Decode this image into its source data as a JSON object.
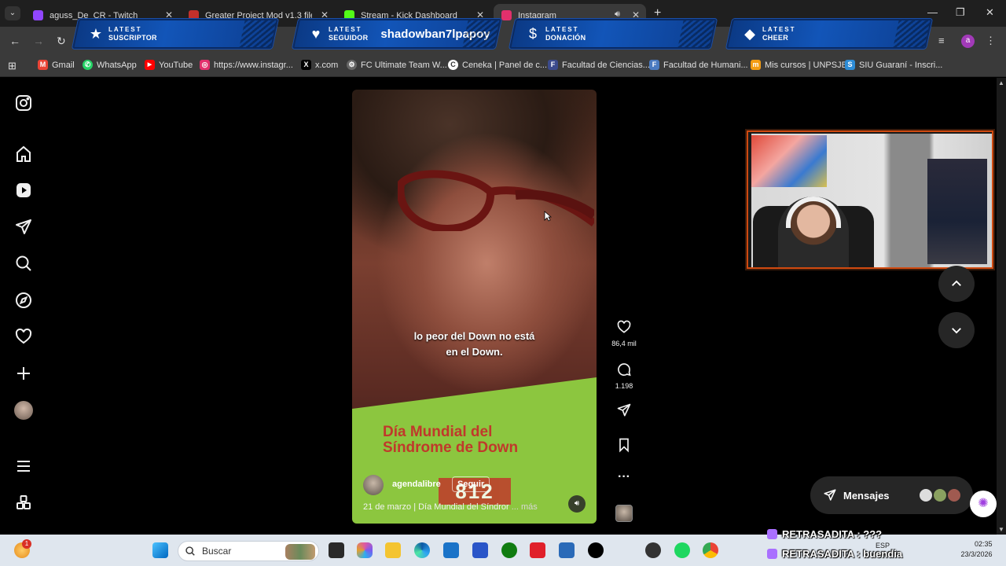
{
  "tabs": [
    {
      "title": "aguss_De_CR - Twitch",
      "color": "#9146ff",
      "active": false
    },
    {
      "title": "Greater Project Mod v1.3 file - ",
      "color": "#c4302b",
      "active": false
    },
    {
      "title": "Stream - Kick Dashboard",
      "color": "#53fc18",
      "active": false
    },
    {
      "title": "Instagram",
      "color": "#e1306c",
      "active": true
    }
  ],
  "overlay_banners": [
    {
      "line1": "LATEST",
      "line2": "SUSCRIPTOR",
      "value": "",
      "icon": "star-icon"
    },
    {
      "line1": "LATEST",
      "line2": "SEGUIDOR",
      "value": "shadowban7lpapoy",
      "icon": "heart-icon"
    },
    {
      "line1": "LATEST",
      "line2": "DONACIÓN",
      "value": "",
      "icon": "dollar-icon"
    },
    {
      "line1": "LATEST",
      "line2": "CHEER",
      "value": "",
      "icon": "diamond-icon"
    }
  ],
  "profile_initial": "a",
  "bookmarks": [
    {
      "label": "Gmail",
      "color": "#ea4335",
      "glyph": "M"
    },
    {
      "label": "WhatsApp",
      "color": "#25d366",
      "glyph": "✆"
    },
    {
      "label": "YouTube",
      "color": "#ff0000",
      "glyph": "▶"
    },
    {
      "label": "https://www.instagr...",
      "color": "#e1306c",
      "glyph": "◎"
    },
    {
      "label": "x.com",
      "color": "#000000",
      "glyph": "X"
    },
    {
      "label": "FC Ultimate Team W...",
      "color": "#888888",
      "glyph": "⚙"
    },
    {
      "label": "Ceneka | Panel de c...",
      "color": "#ffffff",
      "glyph": "C"
    },
    {
      "label": "Facultad de Ciencias...",
      "color": "#3b4a8c",
      "glyph": "F"
    },
    {
      "label": "Facultad de Humani...",
      "color": "#4a7ac0",
      "glyph": "F"
    },
    {
      "label": "Mis cursos | UNPSJB",
      "color": "#f39c12",
      "glyph": "m"
    },
    {
      "label": "SIU Guaraní - Inscri...",
      "color": "#2d8cd6",
      "glyph": "S"
    }
  ],
  "reel": {
    "caption_line1": "lo peor del Down no está",
    "caption_line2": "en el Down.",
    "title_line1": "Día Mundial del",
    "title_line2": "Síndrome de Down",
    "username": "agendalibre",
    "follow_label": "Seguir",
    "stamp": "812",
    "date_text": "21 de marzo | Día Mundial del Síndror",
    "more_label": "... más",
    "likes": "86,4 mil",
    "comments": "1.198"
  },
  "messages_label": "Mensajes",
  "taskbar": {
    "search_placeholder": "Buscar",
    "notification_badge": "1",
    "lang": "ESP",
    "time": "02:35",
    "date": "23/3/2026"
  },
  "chat": [
    {
      "text": "RETRASADITA : ???"
    },
    {
      "text": "RETRASADITA : buendia"
    }
  ]
}
